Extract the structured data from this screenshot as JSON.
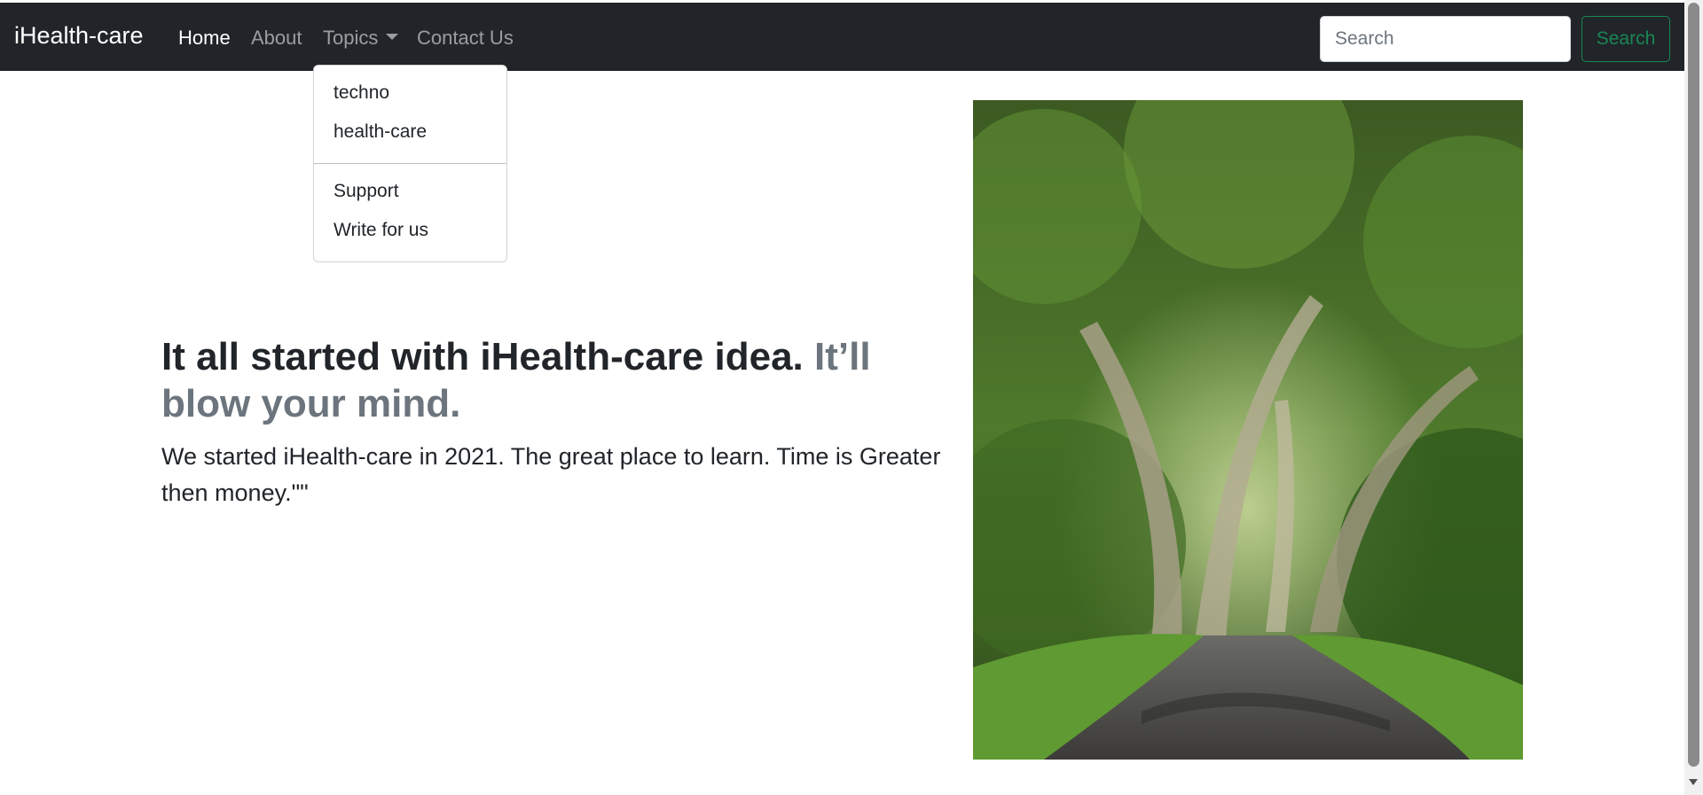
{
  "navbar": {
    "brand": "iHealth-care",
    "links": [
      {
        "label": "Home",
        "active": true
      },
      {
        "label": "About",
        "active": false
      },
      {
        "label": "Topics",
        "active": false
      },
      {
        "label": "Contact Us",
        "active": false
      }
    ],
    "search": {
      "placeholder": "Search",
      "value": "",
      "button_label": "Search"
    },
    "background_color": "#212529"
  },
  "dropdown": {
    "items": [
      {
        "label": "techno"
      },
      {
        "label": "health-care"
      },
      {
        "label": "Support"
      },
      {
        "label": "Write for us"
      }
    ]
  },
  "hero": {
    "heading": "It all started with iHealth-care idea.",
    "heading_muted": "It’ll blow your mind.",
    "lead": "We started iHealth-care in 2021. The great place to learn. Time is Greater then money.\"\"",
    "image": "forest-road-photo"
  },
  "colors": {
    "accent_success": "#198754",
    "muted_text": "#6c757d",
    "body_text": "#212529"
  }
}
